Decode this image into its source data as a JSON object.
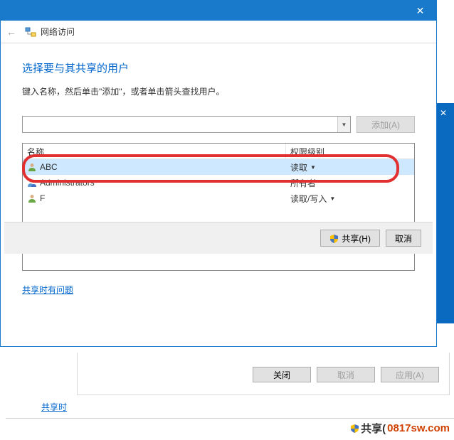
{
  "title_bar": {
    "close": "✕"
  },
  "header": {
    "back": "←",
    "title": "网络访问"
  },
  "main": {
    "heading": "选择要与其共享的用户",
    "subtitle": "键入名称，然后单击\"添加\"，或者单击箭头查找用户。",
    "add_button": "添加(A)"
  },
  "list": {
    "col_name": "名称",
    "col_perm": "权限级别",
    "rows": [
      {
        "name": "ABC",
        "perm": "读取",
        "has_dropdown": true,
        "selected": true
      },
      {
        "name": "Administrators",
        "perm": "所有者",
        "has_dropdown": false,
        "selected": false
      },
      {
        "name": "F",
        "perm": "读取/写入",
        "has_dropdown": true,
        "selected": false
      }
    ]
  },
  "trouble_link": "共享时有问题",
  "footer": {
    "share": "共享(H)",
    "cancel": "取消"
  },
  "under": {
    "close": "关闭",
    "cancel": "取消",
    "apply": "应用(A)",
    "link": "共享时"
  },
  "watermark": {
    "share": "共享(",
    "site": "0817sw.com"
  },
  "bg": {
    "close": "✕"
  }
}
